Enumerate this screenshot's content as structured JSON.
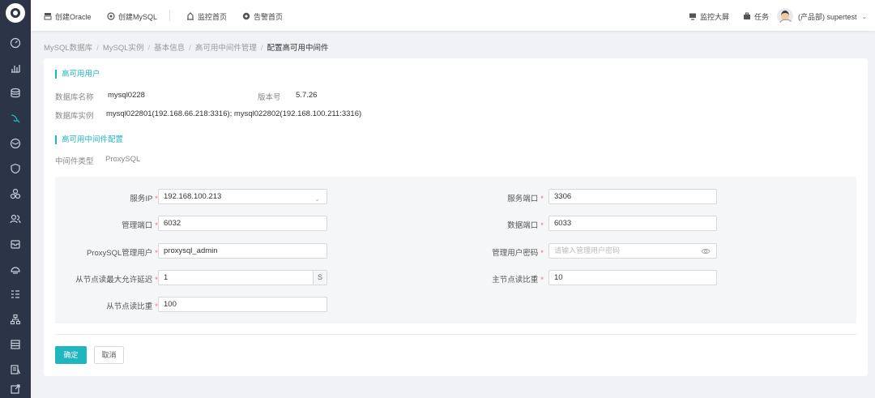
{
  "topbar": {
    "create_oracle": "创建Oracle",
    "create_mysql": "创建MySQL",
    "monitor_home": "监控首页",
    "alert_home": "告警首页",
    "big_screen": "监控大屏",
    "tasks": "任务",
    "user": "(产品部) supertest"
  },
  "breadcrumb": {
    "items": [
      "MySQL数据库",
      "MySQL实例",
      "基本信息",
      "高可用中间件管理"
    ],
    "current": "配置高可用中间件",
    "separator": "/"
  },
  "ha_user": {
    "title": "高可用用户",
    "db_name_label": "数据库名称",
    "db_name_value": "mysql0228",
    "version_label": "版本号",
    "version_value": "5.7.26",
    "db_instance_label": "数据库实例",
    "db_instance_value": "mysql022801(192.168.66.218:3316); mysql022802(192.168.100.211:3316)"
  },
  "ha_middleware": {
    "title": "高可用中间件配置",
    "type_label": "中间件类型",
    "type_value": "ProxySQL"
  },
  "form": {
    "service_ip_label": "服务IP",
    "service_ip_value": "192.168.100.213",
    "service_port_label": "服务端口",
    "service_port_value": "3306",
    "admin_port_label": "管理端口",
    "admin_port_value": "6032",
    "data_port_label": "数据端口",
    "data_port_value": "6033",
    "proxysql_user_label": "ProxySQL管理用户",
    "proxysql_user_value": "proxysql_admin",
    "admin_password_label": "管理用户密码",
    "admin_password_placeholder": "请输入管理用户密码",
    "slave_delay_label": "从节点读最大允许延迟",
    "slave_delay_value": "1",
    "slave_delay_unit": "S",
    "master_weight_label": "主节点读比重",
    "master_weight_value": "10",
    "slave_weight_label": "从节点读比重",
    "slave_weight_value": "100",
    "required_mark": "*"
  },
  "actions": {
    "confirm": "确定",
    "cancel": "取消"
  },
  "colors": {
    "accent": "#1fb6c0",
    "sidebar": "#2b3547",
    "required": "#f56c6c"
  }
}
